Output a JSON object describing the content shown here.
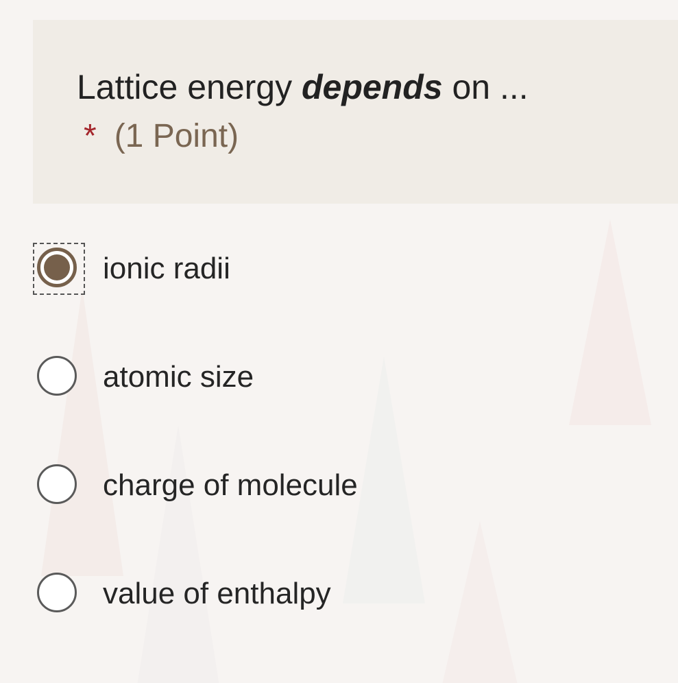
{
  "question": {
    "title_prefix": "Lattice energy ",
    "title_emphasis": "depends",
    "title_suffix": " on ...",
    "required_marker": "*",
    "points": "(1 Point)"
  },
  "options": [
    {
      "label": "ionic radii",
      "selected": true
    },
    {
      "label": "atomic size",
      "selected": false
    },
    {
      "label": "charge of molecule",
      "selected": false
    },
    {
      "label": "value of enthalpy",
      "selected": false
    }
  ],
  "colors": {
    "accent": "#76604b",
    "required": "#a4262c",
    "card_background": "#f0ece6"
  }
}
